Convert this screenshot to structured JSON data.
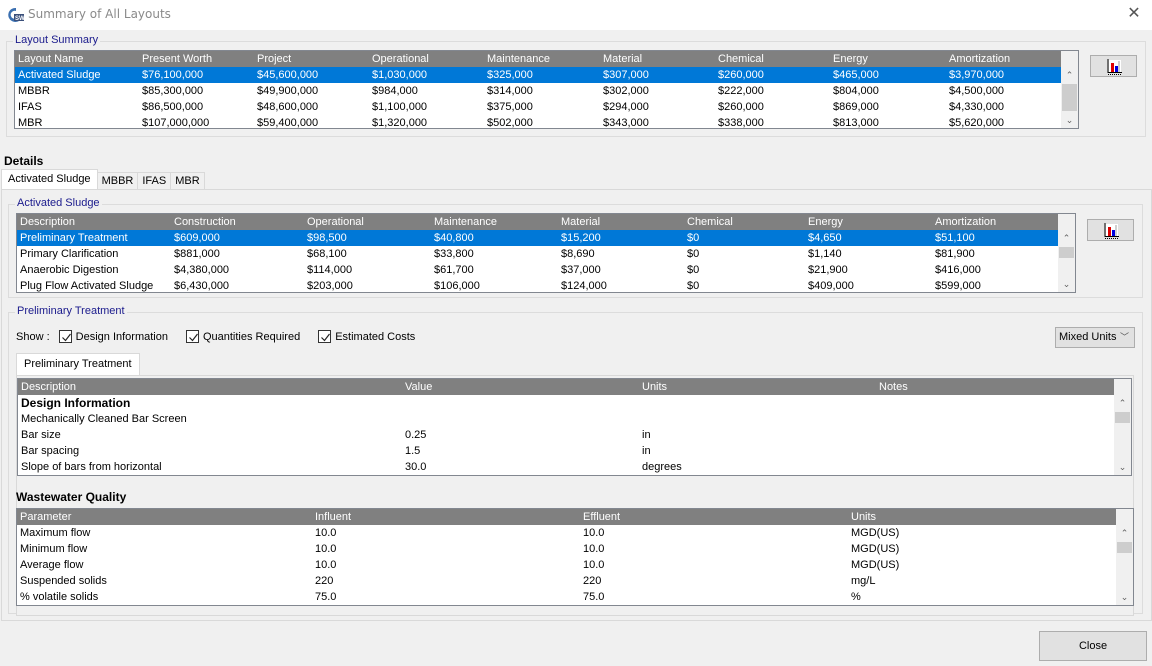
{
  "window": {
    "title": "Summary of All Layouts",
    "icon": "gps-x-app-icon",
    "close_icon": "close-icon"
  },
  "layout_summary": {
    "legend": "Layout Summary",
    "columns": [
      "Layout Name",
      "Present Worth",
      "Project",
      "Operational",
      "Maintenance",
      "Material",
      "Chemical",
      "Energy",
      "Amortization"
    ],
    "rows": [
      [
        "Activated Sludge",
        "$76,100,000",
        "$45,600,000",
        "$1,030,000",
        "$325,000",
        "$307,000",
        "$260,000",
        "$465,000",
        "$3,970,000"
      ],
      [
        "MBBR",
        "$85,300,000",
        "$49,900,000",
        "$984,000",
        "$314,000",
        "$302,000",
        "$222,000",
        "$804,000",
        "$4,500,000"
      ],
      [
        "IFAS",
        "$86,500,000",
        "$48,600,000",
        "$1,100,000",
        "$375,000",
        "$294,000",
        "$260,000",
        "$869,000",
        "$4,330,000"
      ],
      [
        "MBR",
        "$107,000,000",
        "$59,400,000",
        "$1,320,000",
        "$502,000",
        "$343,000",
        "$338,000",
        "$813,000",
        "$5,620,000"
      ]
    ],
    "selected_row": 0,
    "chart_button_icon": "bar-chart-icon"
  },
  "details": {
    "title": "Details",
    "tabs": [
      "Activated Sludge",
      "MBBR",
      "IFAS",
      "MBR"
    ],
    "active_tab": 0,
    "unit_group": {
      "legend": "Activated Sludge",
      "columns": [
        "Description",
        "Construction",
        "Operational",
        "Maintenance",
        "Material",
        "Chemical",
        "Energy",
        "Amortization"
      ],
      "rows": [
        [
          "Preliminary Treatment",
          "$609,000",
          "$98,500",
          "$40,800",
          "$15,200",
          "$0",
          "$4,650",
          "$51,100"
        ],
        [
          "Primary Clarification",
          "$881,000",
          "$68,100",
          "$33,800",
          "$8,690",
          "$0",
          "$1,140",
          "$81,900"
        ],
        [
          "Anaerobic Digestion",
          "$4,380,000",
          "$114,000",
          "$61,700",
          "$37,000",
          "$0",
          "$21,900",
          "$416,000"
        ],
        [
          "Plug Flow Activated Sludge",
          "$6,430,000",
          "$203,000",
          "$106,000",
          "$124,000",
          "$0",
          "$409,000",
          "$599,000"
        ]
      ],
      "selected_row": 0
    },
    "process": {
      "legend": "Preliminary Treatment",
      "show_label": "Show :",
      "checkboxes": [
        {
          "label": "Design Information",
          "checked": true
        },
        {
          "label": "Quantities Required",
          "checked": true
        },
        {
          "label": "Estimated Costs",
          "checked": true
        }
      ],
      "units_dropdown": {
        "selected": "Mixed Units"
      },
      "inner_tab": "Preliminary Treatment",
      "design_table": {
        "columns": [
          "Description",
          "Value",
          "Units",
          "Notes"
        ],
        "rows": [
          {
            "cells": [
              "Design Information",
              "",
              "",
              ""
            ],
            "section": true
          },
          {
            "cells": [
              "Mechanically Cleaned Bar Screen",
              "",
              "",
              ""
            ]
          },
          {
            "cells": [
              "Bar size",
              "0.25",
              "in",
              ""
            ]
          },
          {
            "cells": [
              "Bar spacing",
              "1.5",
              "in",
              ""
            ]
          },
          {
            "cells": [
              "Slope of bars from horizontal",
              "30.0",
              "degrees",
              ""
            ]
          }
        ]
      },
      "wastewater": {
        "title": "Wastewater Quality",
        "columns": [
          "Parameter",
          "Influent",
          "Effluent",
          "Units"
        ],
        "rows": [
          [
            "Maximum flow",
            "10.0",
            "10.0",
            "MGD(US)"
          ],
          [
            "Minimum flow",
            "10.0",
            "10.0",
            "MGD(US)"
          ],
          [
            "Average flow",
            "10.0",
            "10.0",
            "MGD(US)"
          ],
          [
            "Suspended solids",
            "220",
            "220",
            "mg/L"
          ],
          [
            "% volatile solids",
            "75.0",
            "75.0",
            "%"
          ]
        ]
      }
    }
  },
  "footer": {
    "close_label": "Close"
  }
}
